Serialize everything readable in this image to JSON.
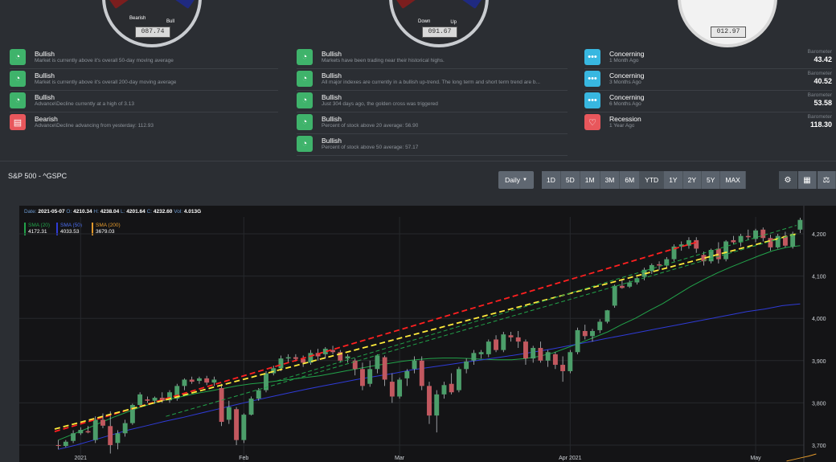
{
  "gauges": [
    {
      "left_label": "Bearish",
      "right_label": "Bull",
      "value": "087.74"
    },
    {
      "left_label": "Down",
      "right_label": "Up",
      "value": "091.67"
    },
    {
      "left_label": "",
      "right_label": "",
      "value": "012.97"
    }
  ],
  "signals_col1": [
    {
      "title": "Bullish",
      "desc": "Market is currently above it's overall 50-day moving average",
      "icon": "gauge-icon",
      "color": "green"
    },
    {
      "title": "Bullish",
      "desc": "Market is currently above it's overall 200-day moving average",
      "icon": "gauge-icon",
      "color": "green"
    },
    {
      "title": "Bullish",
      "desc": "Advance\\Decline currently at a high of 3.13",
      "icon": "gauge-icon",
      "color": "green"
    },
    {
      "title": "Bearish",
      "desc": "Advance\\Decline advancing from yesterday: 112.93",
      "icon": "message-icon",
      "color": "red"
    }
  ],
  "signals_col2": [
    {
      "title": "Bullish",
      "desc": "Markets have been trading near their historical highs.",
      "icon": "gauge-icon",
      "color": "green"
    },
    {
      "title": "Bullish",
      "desc": "All major indexes are currently in a bullish up-trend. The long term and short term trend are b...",
      "icon": "gauge-icon",
      "color": "green"
    },
    {
      "title": "Bullish",
      "desc": "Just 304 days ago, the golden cross was triggered",
      "icon": "gauge-icon",
      "color": "green"
    },
    {
      "title": "Bullish",
      "desc": "Percent of stock above 20 average: 56.90",
      "icon": "gauge-icon",
      "color": "green"
    },
    {
      "title": "Bullish",
      "desc": "Percent of stock above 50 average: 57.17",
      "icon": "gauge-icon",
      "color": "green"
    }
  ],
  "signals_col3": [
    {
      "title": "Concerning",
      "desc": "1 Month Ago",
      "barometer_label": "Barometer",
      "barometer_value": "43.42",
      "color": "blue",
      "icon": "dots-icon"
    },
    {
      "title": "Concerning",
      "desc": "3 Months Ago",
      "barometer_label": "Barometer",
      "barometer_value": "40.52",
      "color": "blue",
      "icon": "dots-icon"
    },
    {
      "title": "Concerning",
      "desc": "6 Months Ago",
      "barometer_label": "Barometer",
      "barometer_value": "53.58",
      "color": "blue",
      "icon": "dots-icon"
    },
    {
      "title": "Recession",
      "desc": "1 Year Ago",
      "barometer_label": "Barometer",
      "barometer_value": "118.30",
      "color": "red",
      "icon": "heart-icon"
    }
  ],
  "chart_panel": {
    "title": "S&P 500 - ^GSPC",
    "interval_label": "Daily",
    "ranges": [
      "1D",
      "5D",
      "1M",
      "3M",
      "6M",
      "YTD",
      "1Y",
      "2Y",
      "5Y",
      "MAX"
    ],
    "active_range": "YTD",
    "tools": [
      "settings-icon",
      "calculator-icon",
      "scale-icon"
    ]
  },
  "ohlc_info": {
    "date_label": "Date:",
    "date": "2021-05-07",
    "o_label": "O:",
    "o": "4210.34",
    "h_label": "H:",
    "h": "4238.04",
    "l_label": "L:",
    "l": "4201.64",
    "c_label": "C:",
    "c": "4232.60",
    "vol_label": "Vol:",
    "vol": "4.013G"
  },
  "legend": [
    {
      "name": "SMA (20)",
      "value": "4172.31",
      "color": "#22a34a"
    },
    {
      "name": "SMA (50)",
      "value": "4033.53",
      "color": "#2f3bd6"
    },
    {
      "name": "SMA (200)",
      "value": "3679.03",
      "color": "#e39a2c"
    }
  ],
  "chart_data": {
    "type": "candlestick",
    "x_labels": [
      "2021",
      "Feb",
      "Mar",
      "Apr 2021",
      "May"
    ],
    "y_ticks": [
      3700,
      3800,
      3900,
      4000,
      4100,
      4200
    ],
    "ylim": [
      3660,
      4240
    ],
    "up_color": "#4c9e6a",
    "down_color": "#c2585f",
    "candles": [
      {
        "o": 3700,
        "h": 3712,
        "l": 3690,
        "c": 3698
      },
      {
        "o": 3698,
        "h": 3712,
        "l": 3695,
        "c": 3708
      },
      {
        "o": 3710,
        "h": 3735,
        "l": 3705,
        "c": 3728
      },
      {
        "o": 3728,
        "h": 3742,
        "l": 3724,
        "c": 3736
      },
      {
        "o": 3733,
        "h": 3745,
        "l": 3728,
        "c": 3730
      },
      {
        "o": 3712,
        "h": 3768,
        "l": 3705,
        "c": 3760
      },
      {
        "o": 3760,
        "h": 3775,
        "l": 3740,
        "c": 3746
      },
      {
        "o": 3745,
        "h": 3780,
        "l": 3680,
        "c": 3700
      },
      {
        "o": 3705,
        "h": 3735,
        "l": 3690,
        "c": 3728
      },
      {
        "o": 3728,
        "h": 3760,
        "l": 3720,
        "c": 3752
      },
      {
        "o": 3752,
        "h": 3798,
        "l": 3748,
        "c": 3795
      },
      {
        "o": 3795,
        "h": 3825,
        "l": 3790,
        "c": 3820
      },
      {
        "o": 3808,
        "h": 3815,
        "l": 3800,
        "c": 3805
      },
      {
        "o": 3805,
        "h": 3815,
        "l": 3798,
        "c": 3812
      },
      {
        "o": 3812,
        "h": 3825,
        "l": 3800,
        "c": 3805
      },
      {
        "o": 3806,
        "h": 3830,
        "l": 3800,
        "c": 3825
      },
      {
        "o": 3810,
        "h": 3845,
        "l": 3805,
        "c": 3840
      },
      {
        "o": 3840,
        "h": 3858,
        "l": 3830,
        "c": 3855
      },
      {
        "o": 3855,
        "h": 3862,
        "l": 3845,
        "c": 3850
      },
      {
        "o": 3852,
        "h": 3862,
        "l": 3845,
        "c": 3858
      },
      {
        "o": 3858,
        "h": 3864,
        "l": 3842,
        "c": 3848
      },
      {
        "o": 3848,
        "h": 3862,
        "l": 3840,
        "c": 3855
      },
      {
        "o": 3835,
        "h": 3845,
        "l": 3745,
        "c": 3755
      },
      {
        "o": 3760,
        "h": 3805,
        "l": 3750,
        "c": 3790
      },
      {
        "o": 3785,
        "h": 3790,
        "l": 3700,
        "c": 3712
      },
      {
        "o": 3712,
        "h": 3775,
        "l": 3705,
        "c": 3772
      },
      {
        "o": 3772,
        "h": 3815,
        "l": 3770,
        "c": 3810
      },
      {
        "o": 3810,
        "h": 3835,
        "l": 3805,
        "c": 3830
      },
      {
        "o": 3830,
        "h": 3875,
        "l": 3825,
        "c": 3870
      },
      {
        "o": 3870,
        "h": 3888,
        "l": 3865,
        "c": 3882
      },
      {
        "o": 3882,
        "h": 3912,
        "l": 3875,
        "c": 3905
      },
      {
        "o": 3905,
        "h": 3915,
        "l": 3895,
        "c": 3908
      },
      {
        "o": 3908,
        "h": 3915,
        "l": 3898,
        "c": 3904
      },
      {
        "o": 3904,
        "h": 3912,
        "l": 3885,
        "c": 3895
      },
      {
        "o": 3895,
        "h": 3925,
        "l": 3890,
        "c": 3918
      },
      {
        "o": 3918,
        "h": 3928,
        "l": 3900,
        "c": 3910
      },
      {
        "o": 3915,
        "h": 3932,
        "l": 3905,
        "c": 3928
      },
      {
        "o": 3925,
        "h": 3935,
        "l": 3915,
        "c": 3920
      },
      {
        "o": 3920,
        "h": 3925,
        "l": 3895,
        "c": 3900
      },
      {
        "o": 3905,
        "h": 3915,
        "l": 3895,
        "c": 3910
      },
      {
        "o": 3900,
        "h": 3905,
        "l": 3865,
        "c": 3880
      },
      {
        "o": 3880,
        "h": 3895,
        "l": 3830,
        "c": 3840
      },
      {
        "o": 3845,
        "h": 3900,
        "l": 3838,
        "c": 3880
      },
      {
        "o": 3880,
        "h": 3915,
        "l": 3870,
        "c": 3912
      },
      {
        "o": 3908,
        "h": 3912,
        "l": 3840,
        "c": 3855
      },
      {
        "o": 3850,
        "h": 3870,
        "l": 3800,
        "c": 3815
      },
      {
        "o": 3815,
        "h": 3860,
        "l": 3810,
        "c": 3855
      },
      {
        "o": 3858,
        "h": 3880,
        "l": 3840,
        "c": 3875
      },
      {
        "o": 3880,
        "h": 3910,
        "l": 3870,
        "c": 3900
      },
      {
        "o": 3900,
        "h": 3910,
        "l": 3830,
        "c": 3840
      },
      {
        "o": 3840,
        "h": 3850,
        "l": 3750,
        "c": 3770
      },
      {
        "o": 3770,
        "h": 3830,
        "l": 3730,
        "c": 3820
      },
      {
        "o": 3820,
        "h": 3850,
        "l": 3810,
        "c": 3842
      },
      {
        "o": 3845,
        "h": 3870,
        "l": 3820,
        "c": 3825
      },
      {
        "o": 3830,
        "h": 3885,
        "l": 3825,
        "c": 3880
      },
      {
        "o": 3880,
        "h": 3905,
        "l": 3870,
        "c": 3898
      },
      {
        "o": 3900,
        "h": 3925,
        "l": 3890,
        "c": 3918
      },
      {
        "o": 3915,
        "h": 3925,
        "l": 3905,
        "c": 3920
      },
      {
        "o": 3915,
        "h": 3950,
        "l": 3908,
        "c": 3945
      },
      {
        "o": 3950,
        "h": 3960,
        "l": 3920,
        "c": 3925
      },
      {
        "o": 3925,
        "h": 3968,
        "l": 3920,
        "c": 3962
      },
      {
        "o": 3960,
        "h": 3968,
        "l": 3945,
        "c": 3955
      },
      {
        "o": 3955,
        "h": 3970,
        "l": 3930,
        "c": 3945
      },
      {
        "o": 3945,
        "h": 3950,
        "l": 3890,
        "c": 3905
      },
      {
        "o": 3905,
        "h": 3935,
        "l": 3895,
        "c": 3930
      },
      {
        "o": 3930,
        "h": 3945,
        "l": 3895,
        "c": 3900
      },
      {
        "o": 3900,
        "h": 3925,
        "l": 3885,
        "c": 3920
      },
      {
        "o": 3915,
        "h": 3920,
        "l": 3880,
        "c": 3890
      },
      {
        "o": 3890,
        "h": 3910,
        "l": 3850,
        "c": 3875
      },
      {
        "o": 3875,
        "h": 3925,
        "l": 3870,
        "c": 3920
      },
      {
        "o": 3920,
        "h": 3978,
        "l": 3915,
        "c": 3972
      },
      {
        "o": 3970,
        "h": 3985,
        "l": 3950,
        "c": 3958
      },
      {
        "o": 3958,
        "h": 3975,
        "l": 3945,
        "c": 3970
      },
      {
        "o": 3972,
        "h": 3998,
        "l": 3965,
        "c": 3992
      },
      {
        "o": 3992,
        "h": 4020,
        "l": 3988,
        "c": 4019
      },
      {
        "o": 4030,
        "h": 4080,
        "l": 4025,
        "c": 4077
      },
      {
        "o": 4077,
        "h": 4090,
        "l": 4070,
        "c": 4072
      },
      {
        "o": 4075,
        "h": 4090,
        "l": 4072,
        "c": 4085
      },
      {
        "o": 4085,
        "h": 4098,
        "l": 4080,
        "c": 4095
      },
      {
        "o": 4098,
        "h": 4120,
        "l": 4090,
        "c": 4115
      },
      {
        "o": 4112,
        "h": 4130,
        "l": 4105,
        "c": 4126
      },
      {
        "o": 4128,
        "h": 4135,
        "l": 4115,
        "c": 4125
      },
      {
        "o": 4125,
        "h": 4145,
        "l": 4120,
        "c": 4140
      },
      {
        "o": 4140,
        "h": 4175,
        "l": 4135,
        "c": 4170
      },
      {
        "o": 4170,
        "h": 4182,
        "l": 4160,
        "c": 4175
      },
      {
        "o": 4172,
        "h": 4192,
        "l": 4165,
        "c": 4185
      },
      {
        "o": 4185,
        "h": 4192,
        "l": 4155,
        "c": 4165
      },
      {
        "o": 4150,
        "h": 4158,
        "l": 4125,
        "c": 4135
      },
      {
        "o": 4135,
        "h": 4165,
        "l": 4130,
        "c": 4162
      },
      {
        "o": 4165,
        "h": 4180,
        "l": 4130,
        "c": 4140
      },
      {
        "o": 4140,
        "h": 4185,
        "l": 4135,
        "c": 4182
      },
      {
        "o": 4185,
        "h": 4195,
        "l": 4175,
        "c": 4180
      },
      {
        "o": 4180,
        "h": 4200,
        "l": 4170,
        "c": 4195
      },
      {
        "o": 4195,
        "h": 4210,
        "l": 4185,
        "c": 4192
      },
      {
        "o": 4188,
        "h": 4212,
        "l": 4180,
        "c": 4208
      },
      {
        "o": 4210,
        "h": 4215,
        "l": 4182,
        "c": 4190
      },
      {
        "o": 4190,
        "h": 4198,
        "l": 4160,
        "c": 4168
      },
      {
        "o": 4168,
        "h": 4200,
        "l": 4165,
        "c": 4195
      },
      {
        "o": 4195,
        "h": 4205,
        "l": 4168,
        "c": 4172
      },
      {
        "o": 4170,
        "h": 4205,
        "l": 4165,
        "c": 4200
      },
      {
        "o": 4210,
        "h": 4238,
        "l": 4202,
        "c": 4233
      }
    ],
    "series": [
      {
        "name": "SMA (20)",
        "color": "#22a34a",
        "values": [
          3712,
          3725,
          3738,
          3752,
          3766,
          3778,
          3790,
          3800,
          3808,
          3815,
          3822,
          3828,
          3834,
          3840,
          3845,
          3848,
          3852,
          3856,
          3860,
          3864,
          3870,
          3876,
          3882,
          3888,
          3893,
          3898,
          3902,
          3905,
          3906,
          3906,
          3905,
          3903,
          3902,
          3902,
          3905,
          3910,
          3918,
          3930,
          3942,
          3955,
          3968,
          3985,
          4000,
          4018,
          4035,
          4055,
          4075,
          4092,
          4108,
          4122,
          4135,
          4148,
          4160,
          4168,
          4172
        ]
      },
      {
        "name": "SMA (50)",
        "color": "#2f3bd6",
        "values": [
          3690,
          3700,
          3712,
          3724,
          3736,
          3746,
          3756,
          3765,
          3775,
          3785,
          3795,
          3805,
          3814,
          3823,
          3832,
          3840,
          3848,
          3856,
          3863,
          3870,
          3878,
          3884,
          3890,
          3896,
          3902,
          3908,
          3914,
          3921,
          3928,
          3936,
          3944,
          3952,
          3960,
          3968,
          3976,
          3984,
          3992,
          4000,
          4008,
          4016,
          4022,
          4030,
          4034
        ]
      },
      {
        "name": "SMA (200)",
        "color": "#e39a2c",
        "values": [
          3662,
          3666,
          3670,
          3674,
          3679
        ]
      }
    ],
    "trend_lines": [
      {
        "color": "#ff2020",
        "from": [
          0,
          3732
        ],
        "to": [
          100,
          4250
        ]
      },
      {
        "color": "#ffeb3b",
        "from": [
          0,
          3738
        ],
        "to": [
          100,
          4200
        ]
      },
      {
        "color": "#22a34a",
        "from": [
          15,
          3768
        ],
        "to": [
          100,
          4200
        ]
      },
      {
        "color": "#22a34a",
        "from": [
          30,
          3852
        ],
        "to": [
          100,
          4220
        ]
      }
    ]
  }
}
